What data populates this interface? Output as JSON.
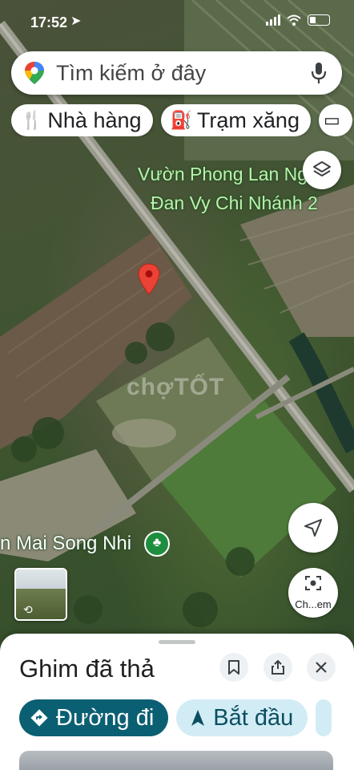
{
  "status_bar": {
    "time": "17:52"
  },
  "search": {
    "placeholder": "Tìm kiếm ở đây"
  },
  "chips": [
    {
      "icon": "fork-knife-icon",
      "label": "Nhà hàng"
    },
    {
      "icon": "gas-pump-icon",
      "label": "Trạm xăng"
    }
  ],
  "map": {
    "labels": {
      "place_line1": "Vườn Phong Lan Ngọc",
      "place_line2": "Đan Vy Chi Nhánh 2",
      "place_bottom": "n Mai Song Nhi"
    },
    "watermark": "chợTỐT"
  },
  "controls": {
    "lens_label": "Ch...em"
  },
  "sheet": {
    "title": "Ghim đã thả",
    "directions_label": "Đường đi",
    "start_label": "Bắt đầu"
  },
  "colors": {
    "marker": "#ea4335",
    "directions_bg": "#0b5f72",
    "start_bg": "#d2ecf5"
  }
}
